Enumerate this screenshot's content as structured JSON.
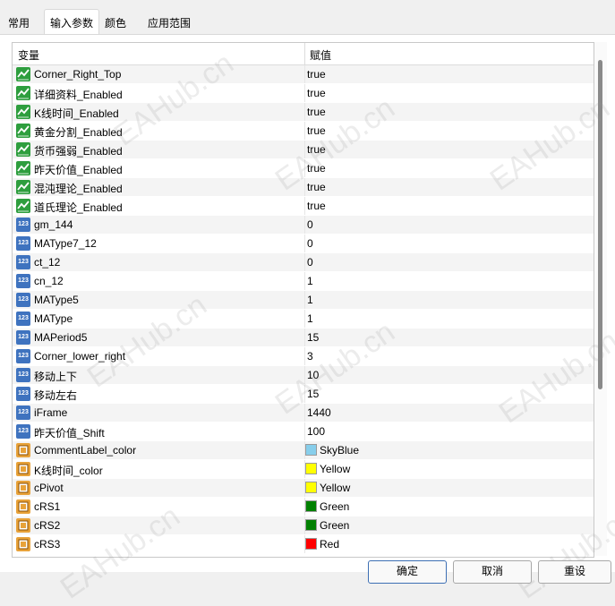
{
  "tabs": [
    {
      "label": "常用",
      "active": false
    },
    {
      "label": "输入参数",
      "active": true
    },
    {
      "label": "颜色",
      "active": false
    },
    {
      "label": "应用范围",
      "active": false
    }
  ],
  "table": {
    "col_variable": "变量",
    "col_value": "赋值",
    "rows": [
      {
        "type": "bool",
        "icon": "bool-icon",
        "name": "Corner_Right_Top",
        "value": "true"
      },
      {
        "type": "bool",
        "icon": "bool-icon",
        "name": "详细资料_Enabled",
        "value": "true"
      },
      {
        "type": "bool",
        "icon": "bool-icon",
        "name": "K线时间_Enabled",
        "value": "true"
      },
      {
        "type": "bool",
        "icon": "bool-icon",
        "name": "黄金分割_Enabled",
        "value": "true"
      },
      {
        "type": "bool",
        "icon": "bool-icon",
        "name": "货币强弱_Enabled",
        "value": "true"
      },
      {
        "type": "bool",
        "icon": "bool-icon",
        "name": "昨天价值_Enabled",
        "value": "true"
      },
      {
        "type": "bool",
        "icon": "bool-icon",
        "name": "混沌理论_Enabled",
        "value": "true"
      },
      {
        "type": "bool",
        "icon": "bool-icon",
        "name": "道氏理论_Enabled",
        "value": "true"
      },
      {
        "type": "int",
        "icon": "integer-icon",
        "name": "gm_144",
        "value": "0"
      },
      {
        "type": "int",
        "icon": "integer-icon",
        "name": "MAType7_12",
        "value": "0"
      },
      {
        "type": "int",
        "icon": "integer-icon",
        "name": "ct_12",
        "value": "0"
      },
      {
        "type": "int",
        "icon": "integer-icon",
        "name": "cn_12",
        "value": "1"
      },
      {
        "type": "int",
        "icon": "integer-icon",
        "name": "MAType5",
        "value": "1"
      },
      {
        "type": "int",
        "icon": "integer-icon",
        "name": "MAType",
        "value": "1"
      },
      {
        "type": "int",
        "icon": "integer-icon",
        "name": "MAPeriod5",
        "value": "15"
      },
      {
        "type": "int",
        "icon": "integer-icon",
        "name": "Corner_lower_right",
        "value": "3"
      },
      {
        "type": "int",
        "icon": "integer-icon",
        "name": "移动上下",
        "value": "10"
      },
      {
        "type": "int",
        "icon": "integer-icon",
        "name": "移动左右",
        "value": "15"
      },
      {
        "type": "int",
        "icon": "integer-icon",
        "name": "iFrame",
        "value": "1440"
      },
      {
        "type": "int",
        "icon": "integer-icon",
        "name": "昨天价值_Shift",
        "value": "100"
      },
      {
        "type": "color",
        "icon": "color-icon",
        "name": "CommentLabel_color",
        "value": "SkyBlue",
        "swatch": "#87ceeb"
      },
      {
        "type": "color",
        "icon": "color-icon",
        "name": "K线时间_color",
        "value": "Yellow",
        "swatch": "#ffff00"
      },
      {
        "type": "color",
        "icon": "color-icon",
        "name": "cPivot",
        "value": "Yellow",
        "swatch": "#ffff00"
      },
      {
        "type": "color",
        "icon": "color-icon",
        "name": "cRS1",
        "value": "Green",
        "swatch": "#008000"
      },
      {
        "type": "color",
        "icon": "color-icon",
        "name": "cRS2",
        "value": "Green",
        "swatch": "#008000"
      },
      {
        "type": "color",
        "icon": "color-icon",
        "name": "cRS3",
        "value": "Red",
        "swatch": "#ff0000"
      }
    ]
  },
  "watermark": "EAHub.cn",
  "buttons": {
    "ok": "确定",
    "cancel": "取消",
    "reset": "重设"
  }
}
